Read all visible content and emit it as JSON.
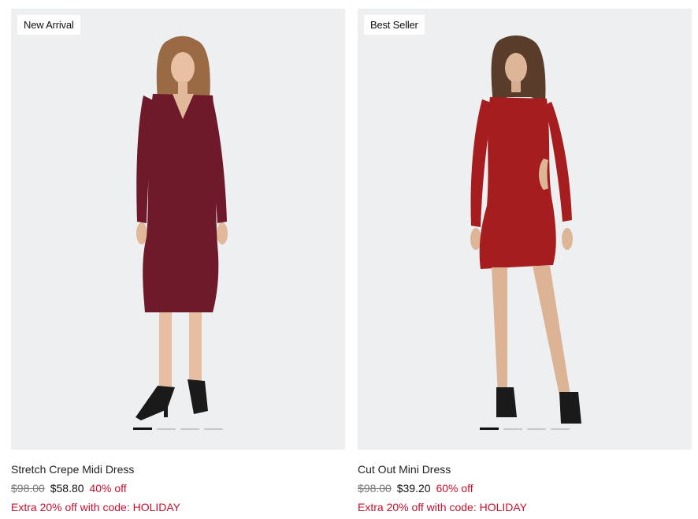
{
  "products": [
    {
      "badge": "New Arrival",
      "name": "Stretch Crepe Midi Dress",
      "original_price": "$98.00",
      "sale_price": "$58.80",
      "discount": "40% off",
      "promo": "Extra 20% off with code: HOLIDAY",
      "dress_color": "#6e1a2a",
      "active_image": 1,
      "image_count": 4
    },
    {
      "badge": "Best Seller",
      "name": "Cut Out Mini Dress",
      "original_price": "$98.00",
      "sale_price": "$39.20",
      "discount": "60% off",
      "promo": "Extra 20% off with code: HOLIDAY",
      "dress_color": "#a51d1f",
      "active_image": 1,
      "image_count": 4
    }
  ],
  "colors": {
    "sale_red": "#c8102e",
    "image_bg": "#eeeff1"
  }
}
